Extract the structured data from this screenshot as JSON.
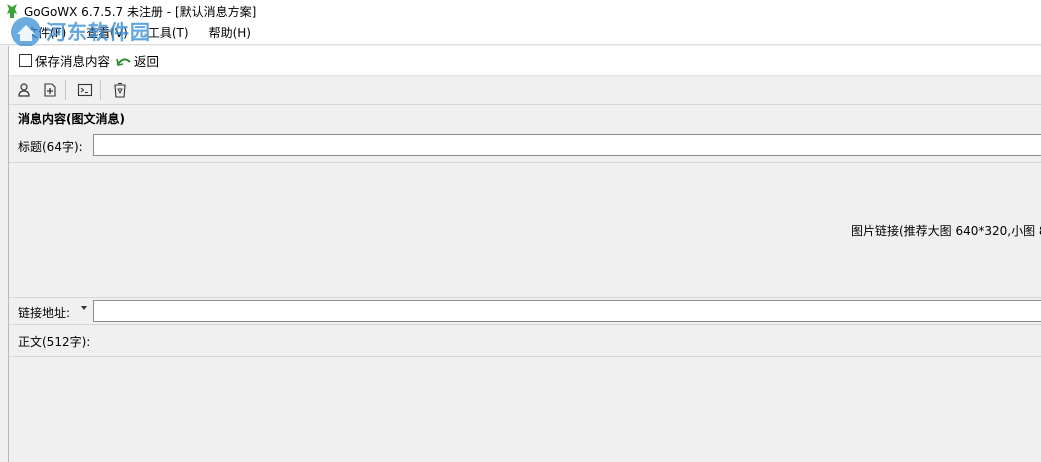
{
  "window": {
    "title": "GoGoWX 6.7.5.7  未注册 - [默认消息方案]"
  },
  "watermark": {
    "text": "河东软件园",
    "url": "www.pc0359.cn"
  },
  "menu": {
    "items": [
      {
        "label": "文件(F)"
      },
      {
        "label": "查看(V)"
      },
      {
        "label": "工具(T)"
      },
      {
        "label": "帮助(H)"
      }
    ]
  },
  "actions": {
    "save_label": "保存消息内容",
    "back_label": "返回"
  },
  "toolbar": {
    "icons": [
      "user-icon",
      "add-page-icon",
      "terminal-icon",
      "recycle-bin-icon"
    ]
  },
  "content": {
    "section_title": "消息内容(图文消息)",
    "title_label": "标题(64字):",
    "title_value": "",
    "image_link_label": "图片链接(推荐大图 640*320,小图 8",
    "link_label": "链接地址:",
    "link_value": "",
    "body_label": "正文(512字):"
  },
  "colors": {
    "background": "#f0f0f0",
    "field_background": "#ffffff",
    "watermark_blue": "#3a8fd6",
    "watermark_green": "#2aa84a",
    "logo_green": "#3aa336"
  }
}
